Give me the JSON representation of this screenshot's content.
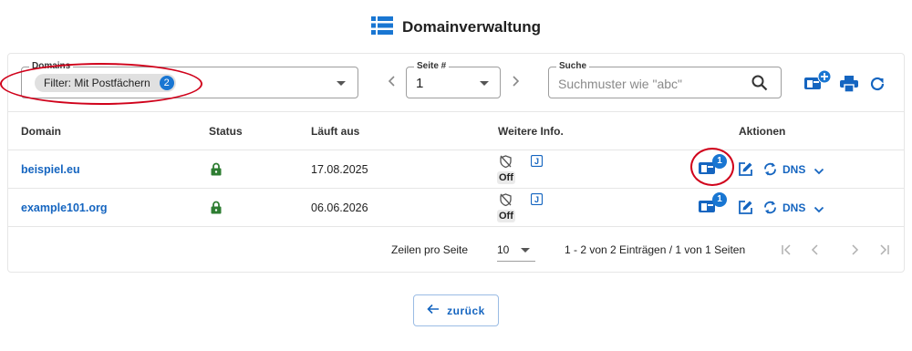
{
  "header": {
    "title": "Domainverwaltung",
    "icon": "list-icon"
  },
  "toolbar": {
    "domains_label": "Domains",
    "filter_chip": "Filter: Mit Postfächern",
    "filter_count": "2",
    "page_label": "Seite #",
    "page_value": "1",
    "search_label": "Suche",
    "search_placeholder": "Suchmuster wie \"abc\"",
    "actions": [
      "add-mailbox-icon",
      "print-icon",
      "refresh-icon"
    ]
  },
  "table": {
    "columns": [
      "Domain",
      "Status",
      "Läuft aus",
      "Weitere Info.",
      "Aktionen"
    ],
    "rows": [
      {
        "domain": "beispiel.eu",
        "status": "lock-icon",
        "expires": "17.08.2025",
        "info_tag": "Off",
        "mailbox_count": "1",
        "dns_label": "DNS"
      },
      {
        "domain": "example101.org",
        "status": "lock-icon",
        "expires": "06.06.2026",
        "info_tag": "Off",
        "mailbox_count": "1",
        "dns_label": "DNS"
      }
    ]
  },
  "footer": {
    "rows_per_page_label": "Zeilen pro Seite",
    "rows_per_page_value": "10",
    "range_text": "1 - 2 von 2 Einträgen / 1 von 1 Seiten"
  },
  "back_button": {
    "label": "zurück"
  },
  "colors": {
    "accent": "#1565c0",
    "badge": "#1976d2",
    "status_ok": "#2e7d32",
    "highlight": "#d0021b"
  }
}
